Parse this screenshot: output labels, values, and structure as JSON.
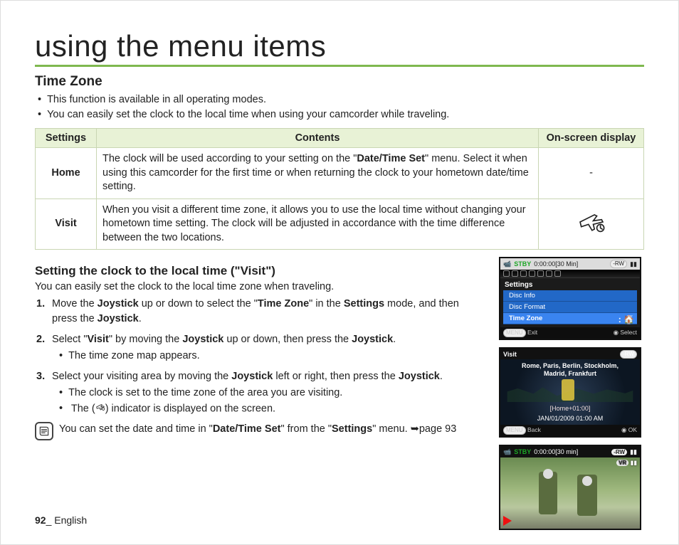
{
  "title": "using the menu items",
  "section": {
    "heading": "Time Zone",
    "bullets": [
      "This function is available in all operating modes.",
      "You can easily set the clock to the local time when using your camcorder while traveling."
    ]
  },
  "table": {
    "headers": {
      "c1": "Settings",
      "c2": "Contents",
      "c3": "On-screen display"
    },
    "rows": [
      {
        "setting": "Home",
        "content_before": "The clock will be used according to your setting on the \"",
        "content_bold": "Date/Time Set",
        "content_after": "\" menu. Select it when using this camcorder for the first time or when returning the clock to your hometown date/time setting.",
        "osd": "-"
      },
      {
        "setting": "Visit",
        "content": "When you visit a different time zone, it allows you to use the local time without changing your hometown time setting. The clock will be adjusted in accordance with the time difference between the two locations.",
        "osd_icon": "plane-clock-icon"
      }
    ]
  },
  "sub": {
    "heading": "Setting the clock to the local time (\"Visit\")",
    "intro": "You can easily set the clock to the local time zone when traveling.",
    "steps": [
      {
        "pre": "Move the ",
        "b1": "Joystick",
        "mid1": " up or down to select the \"",
        "b2": "Time Zone",
        "mid2": "\" in the ",
        "b3": "Settings",
        "mid3": " mode, and then press the ",
        "b4": "Joystick",
        "end": "."
      },
      {
        "pre": "Select \"",
        "b1": "Visit",
        "mid1": "\" by moving the ",
        "b2": "Joystick",
        "mid2": " up or down, then press the ",
        "b3": "Joystick",
        "end": ".",
        "sub": [
          "The time zone map appears."
        ]
      },
      {
        "pre": "Select your visiting area by moving the ",
        "b1": "Joystick",
        "mid1": " left or right, then press the ",
        "b2": "Joystick",
        "end": ".",
        "sub": [
          "The clock is set to the time zone of the area you are visiting.",
          "The (  ) indicator is displayed on the screen."
        ],
        "sub_icon_index": 1
      }
    ],
    "note_pre": "You can set the date and time in \"",
    "note_b1": "Date/Time Set",
    "note_mid": "\" from the \"",
    "note_b2": "Settings",
    "note_post": "\" menu. ➥page 93"
  },
  "osd_panels": {
    "p1": {
      "stby": "STBY",
      "time": "0:00:00[30 Min]",
      "title": "Settings",
      "rows": [
        "Disc Info",
        "Disc Format",
        "Time Zone"
      ],
      "selected": 2,
      "menu": "MENU",
      "exit": "Exit",
      "select": "Select"
    },
    "p2": {
      "title": "Visit",
      "cities_l1": "Rome, Paris, Berlin, Stockholm,",
      "cities_l2": "Madrid, Frankfurt",
      "tag": "[Home+01:00]",
      "date": "JAN/01/2009 01:00 AM",
      "menu": "MENU",
      "back": "Back",
      "ok": "OK"
    },
    "p3": {
      "stby": "STBY",
      "time": "0:00:00[30 min]",
      "rw": "-RW",
      "vr": "VR"
    }
  },
  "footer": {
    "page": "92",
    "sep": "_ ",
    "lang": "English"
  }
}
